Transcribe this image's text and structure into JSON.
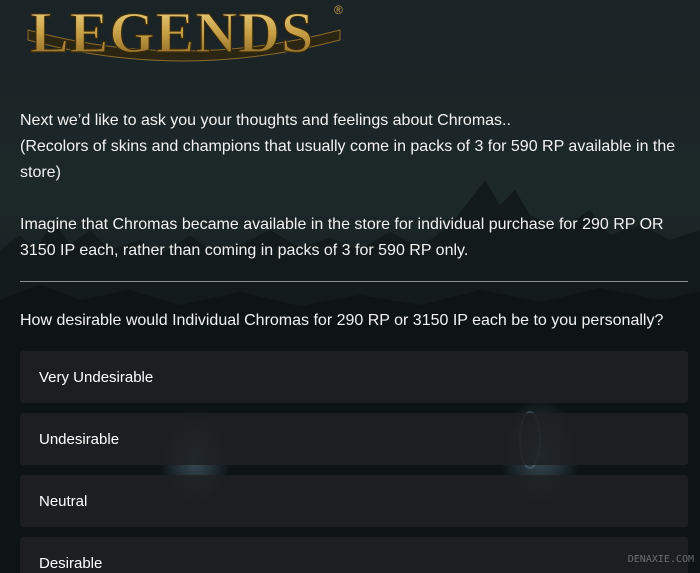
{
  "logo": {
    "text": "LEGENDS",
    "mark": "®"
  },
  "intro": {
    "line1": "Next we’d like to ask you your thoughts and feelings about Chromas..",
    "line2": "(Recolors of skins and champions that usually come in packs of 3 for 590 RP available in the store)",
    "paragraph2": "Imagine that Chromas became available in the store for individual purchase for 290 RP OR 3150 IP each, rather than coming in packs of 3 for 590 RP only."
  },
  "question": {
    "text": "How desirable would Individual Chromas for 290 RP or 3150 IP each be to you personally?"
  },
  "options": [
    {
      "label": "Very Undesirable"
    },
    {
      "label": "Undesirable"
    },
    {
      "label": "Neutral"
    },
    {
      "label": "Desirable"
    }
  ],
  "watermark": {
    "text": "DENAXIE.COM"
  },
  "colors": {
    "background": "#0d1214",
    "text": "#f2f2f2",
    "option_bg": "#1e2123",
    "logo_gold": "#c8a046"
  }
}
